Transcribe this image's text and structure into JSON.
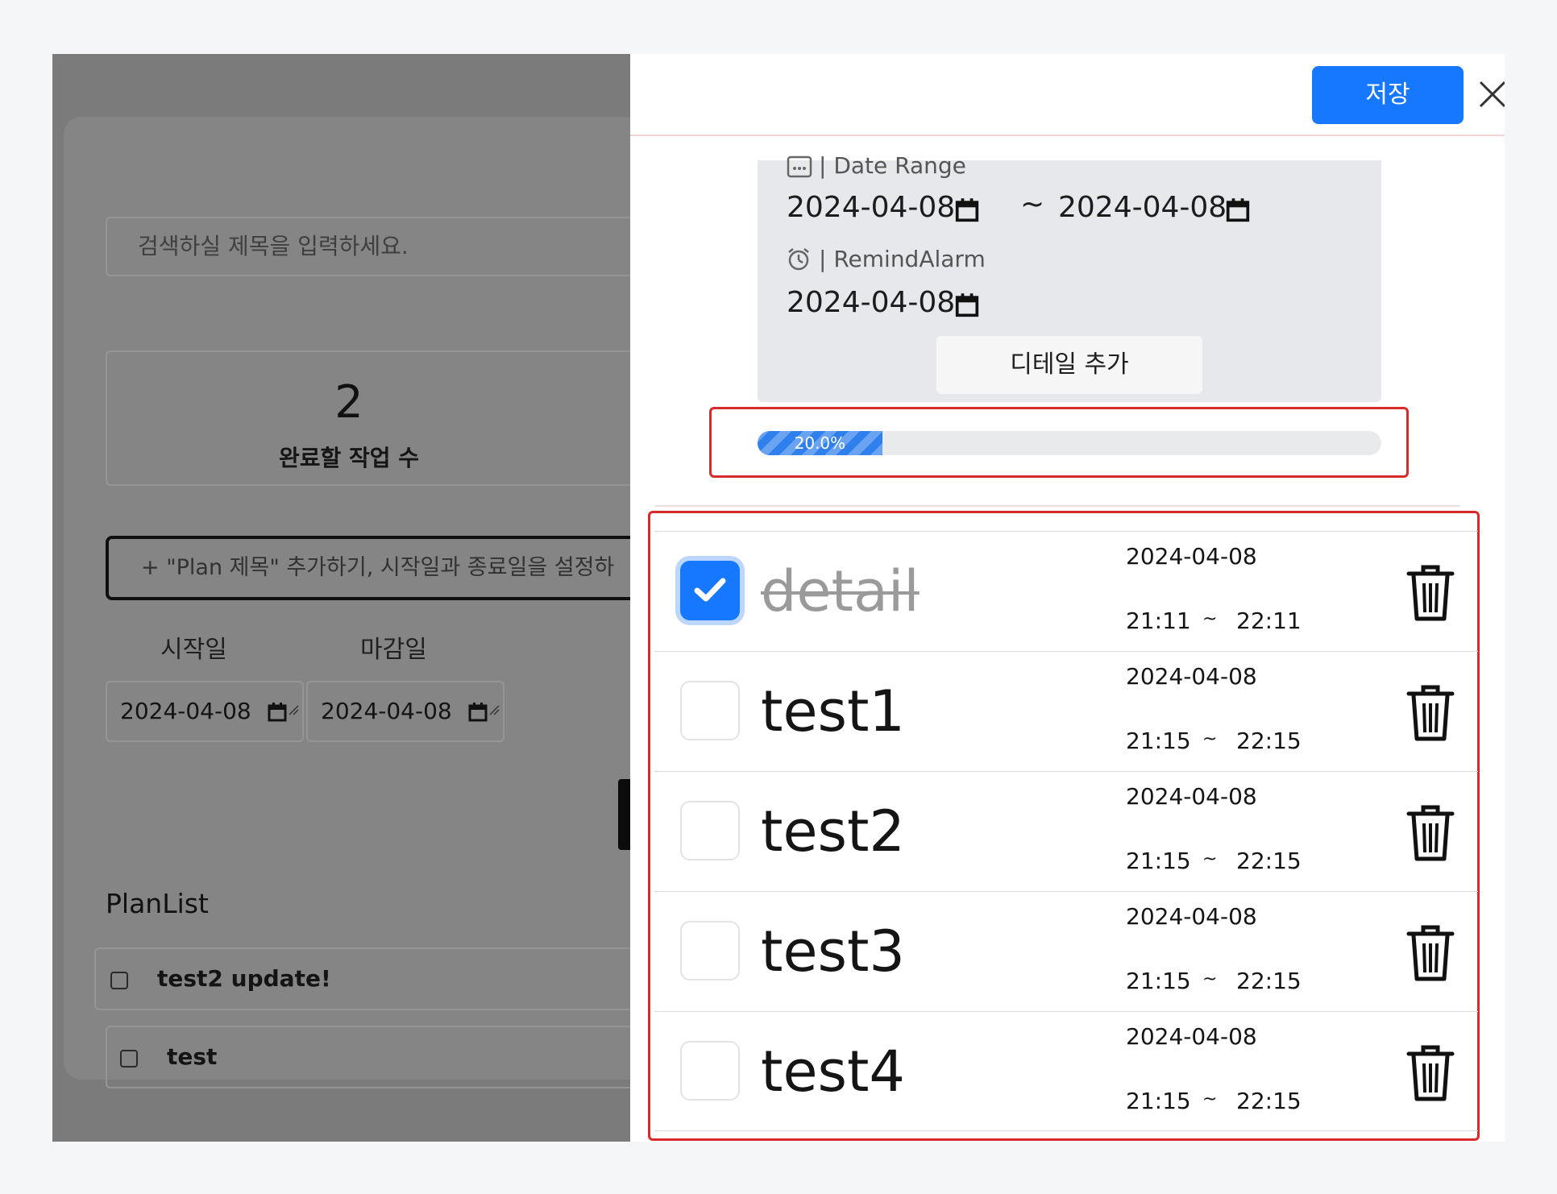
{
  "left_app": {
    "search": {
      "placeholder": "검색하실 제목을 입력하세요."
    },
    "summary": {
      "count": "2",
      "label": "완료할 작업 수"
    },
    "add_plan": {
      "placeholder": "+ \"Plan 제목\" 추가하기, 시작일과 종료일을 설정하"
    },
    "start_label": "시작일",
    "end_label": "마감일",
    "start_date": "2024-04-08",
    "end_date": "2024-04-08",
    "planlist_title": "PlanList",
    "plans": [
      {
        "title": "test2 update!",
        "checked": false
      },
      {
        "title": "test",
        "checked": false
      }
    ]
  },
  "drawer": {
    "save_label": "저장",
    "date_range_label": "| Date Range",
    "range_start": "2024-04-08",
    "range_sep": "~",
    "range_end": "2024-04-08",
    "remind_label": "| RemindAlarm",
    "remind_date": "2024-04-08",
    "add_detail_label": "디테일 추가",
    "progress": {
      "percent": 20.0,
      "label": "20.0%"
    },
    "details": [
      {
        "title": "detail",
        "checked": true,
        "date": "2024-04-08",
        "start": "21:11",
        "sep": "~",
        "end": "22:11"
      },
      {
        "title": "test1",
        "checked": false,
        "date": "2024-04-08",
        "start": "21:15",
        "sep": "~",
        "end": "22:15"
      },
      {
        "title": "test2",
        "checked": false,
        "date": "2024-04-08",
        "start": "21:15",
        "sep": "~",
        "end": "22:15"
      },
      {
        "title": "test3",
        "checked": false,
        "date": "2024-04-08",
        "start": "21:15",
        "sep": "~",
        "end": "22:15"
      },
      {
        "title": "test4",
        "checked": false,
        "date": "2024-04-08",
        "start": "21:15",
        "sep": "~",
        "end": "22:15"
      }
    ]
  },
  "colors": {
    "accent": "#1677ff",
    "highlight_outline": "#d72a2a",
    "overlay": "#7b7b7b"
  }
}
